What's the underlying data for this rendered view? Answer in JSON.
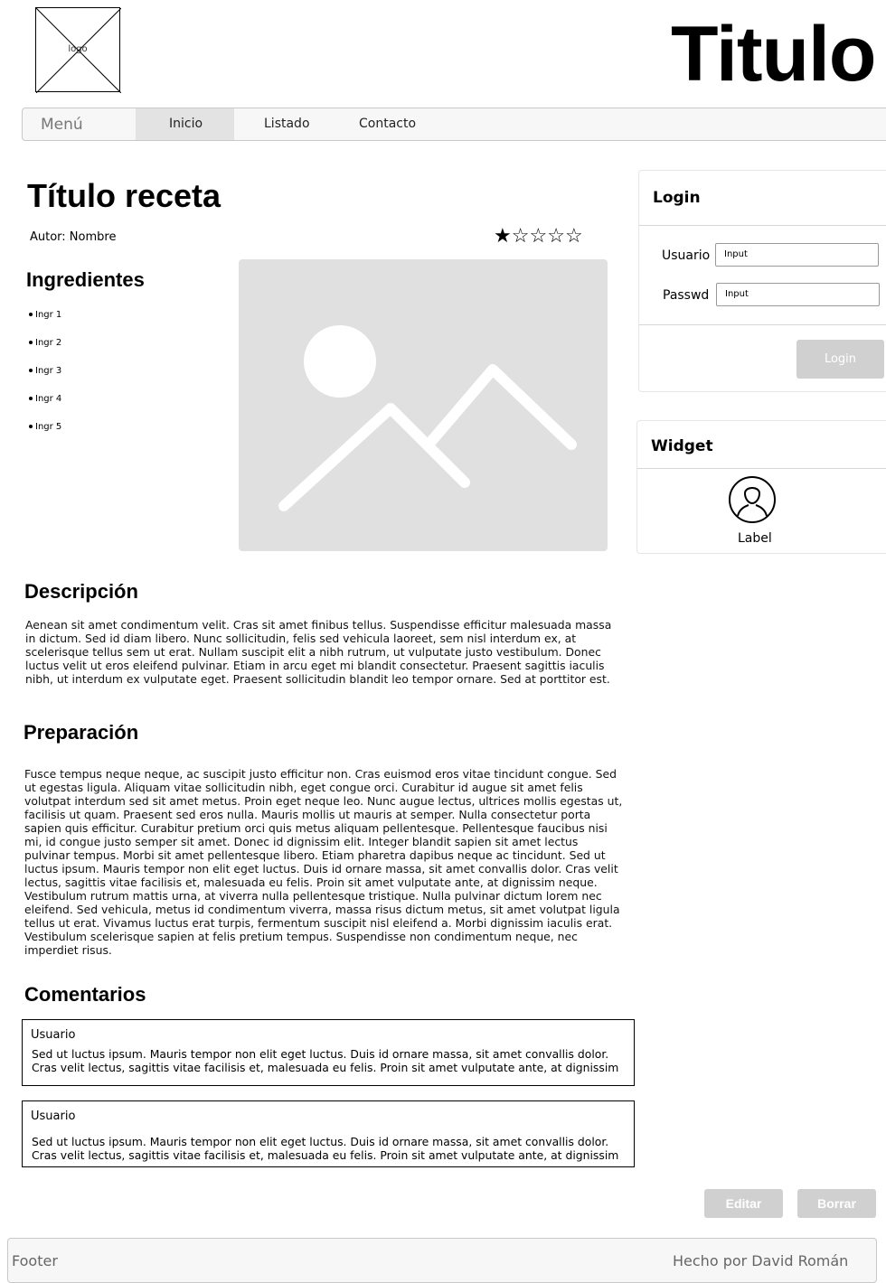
{
  "header": {
    "logo_label": "logo",
    "site_title": "Titulo"
  },
  "nav": {
    "menu_label": "Menú",
    "items": [
      "Inicio",
      "Listado",
      "Contacto"
    ],
    "active_item": "Inicio"
  },
  "recipe": {
    "title": "Título receta",
    "author": "Autor: Nombre",
    "rating": 1,
    "rating_max": 5,
    "ingredients_heading": "Ingredientes",
    "ingredients": [
      "Ingr 1",
      "Ingr 2",
      "Ingr 3",
      "Ingr 4",
      "Ingr 5"
    ],
    "description_heading": "Descripción",
    "description_lines": [
      "Aenean sit amet condimentum velit. Cras sit amet finibus tellus. Suspendisse efficitur malesuada massa",
      "in dictum. Sed id diam libero. Nunc sollicitudin, felis sed vehicula laoreet, sem nisl interdum ex, at",
      "scelerisque tellus sem ut erat. Nullam suscipit elit a nibh rutrum, ut vulputate justo vestibulum. Donec",
      "luctus velit ut eros eleifend pulvinar. Etiam in arcu eget mi blandit consectetur. Praesent sagittis iaculis",
      "nibh, ut interdum ex vulputate eget. Praesent sollicitudin blandit leo tempor ornare. Sed at porttitor est."
    ],
    "preparation_heading": "Preparación",
    "preparation_lines": [
      "Fusce tempus neque neque, ac suscipit justo efficitur non. Cras euismod eros vitae tincidunt congue. Sed",
      "ut egestas ligula. Aliquam vitae sollicitudin nibh, eget congue orci. Curabitur id augue sit amet felis",
      "volutpat interdum sed sit amet metus. Proin eget neque leo. Nunc augue lectus, ultrices mollis egestas ut,",
      "facilisis ut quam. Praesent sed eros nulla. Mauris mollis ut mauris at semper. Nulla consectetur porta",
      "sapien quis efficitur. Curabitur pretium orci quis metus aliquam pellentesque. Pellentesque faucibus nisi",
      "mi, id congue justo semper sit amet. Donec id dignissim elit. Integer blandit sapien sit amet lectus",
      "pulvinar tempus. Morbi sit amet pellentesque libero. Etiam pharetra dapibus neque ac tincidunt.  Sed ut",
      "luctus ipsum. Mauris tempor non elit eget luctus. Duis id ornare massa, sit amet convallis dolor. Cras velit",
      "lectus, sagittis vitae facilisis et, malesuada eu felis. Proin sit amet vulputate ante, at dignissim neque.",
      "Vestibulum rutrum mattis urna, at viverra nulla pellentesque tristique. Nulla pulvinar dictum lorem nec",
      "eleifend. Sed vehicula, metus id condimentum viverra, massa risus dictum metus, sit amet volutpat ligula",
      "tellus ut erat. Vivamus luctus erat turpis, fermentum suscipit nisl eleifend a. Morbi dignissim iaculis erat.",
      "Vestibulum scelerisque sapien at felis pretium tempus. Suspendisse non condimentum neque, nec",
      "imperdiet risus."
    ]
  },
  "comments": {
    "heading": "Comentarios",
    "items": [
      {
        "user": "Usuario",
        "lines": [
          "Sed ut luctus ipsum. Mauris tempor non elit eget luctus. Duis id ornare massa, sit amet convallis dolor.",
          "Cras velit lectus, sagittis vitae facilisis et, malesuada eu felis. Proin sit amet vulputate ante, at dignissim"
        ]
      },
      {
        "user": "Usuario",
        "lines": [
          "Sed ut luctus ipsum. Mauris tempor non elit eget luctus. Duis id ornare massa, sit amet convallis dolor.",
          "Cras velit lectus, sagittis vitae facilisis et, malesuada eu felis. Proin sit amet vulputate ante, at dignissim"
        ]
      }
    ]
  },
  "actions": {
    "edit_label": "Editar",
    "delete_label": "Borrar"
  },
  "login": {
    "title": "Login",
    "user_label": "Usuario",
    "user_value": "Input",
    "pass_label": "Passwd",
    "pass_value": "Input",
    "button_label": "Login"
  },
  "widget": {
    "title": "Widget",
    "label": "Label",
    "icon": "user-icon"
  },
  "footer": {
    "left": "Footer",
    "right": "Hecho por David Román"
  },
  "colors": {
    "nav_active_bg": "#e3e3e3",
    "image_placeholder": "#e0e0e0",
    "button_disabled": "#d0d0d0"
  }
}
